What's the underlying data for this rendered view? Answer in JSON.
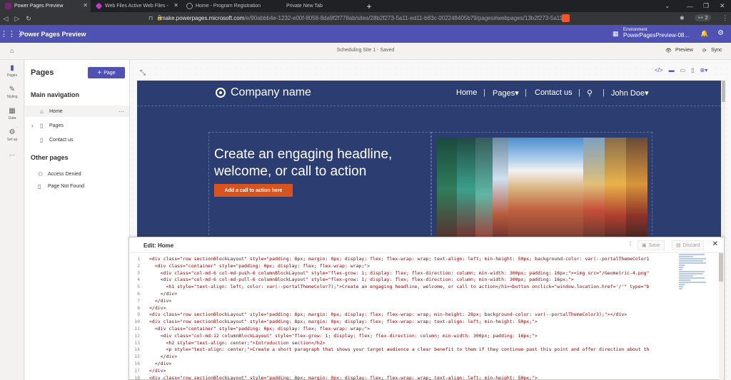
{
  "browser": {
    "tabs": [
      {
        "title": "Power Pages Preview",
        "active": true,
        "icon": "power-pages-icon",
        "color": "#742774"
      },
      {
        "title": "Web Files Active Web Files -",
        "active": false,
        "icon": "power-apps-icon",
        "color": "#c03bc4"
      },
      {
        "title": "Home - Program Registration",
        "active": false,
        "icon": "globe-icon",
        "color": "#9aa0a6"
      },
      {
        "title": "Private New Tab",
        "active": false,
        "icon": "",
        "color": ""
      }
    ],
    "new_tab_label": "+",
    "url_host": "make.powerpages.microsoft.com",
    "url_path": "/e/90abbb4e-1232-e00f-8058-8da9f2f778ab/sites/28b2f273-5a11-ed11-b83c-002248405b79/pages#webpages/13b2f273-5a11...",
    "extension_badge": "2"
  },
  "app": {
    "title": "Power Pages Preview",
    "environment_label": "Environment",
    "environment_name": "PowerPagesPreview-08..."
  },
  "commandbar": {
    "site_status": "Scheduling Site 1 - Saved",
    "preview_label": "Preview",
    "sync_label": "Sync"
  },
  "rail": [
    {
      "label": "Pages",
      "icon": "pages-icon",
      "active": true
    },
    {
      "label": "Styling",
      "icon": "styling-icon",
      "active": false
    },
    {
      "label": "Data",
      "icon": "data-icon",
      "active": false
    },
    {
      "label": "Set up",
      "icon": "setup-icon",
      "active": false
    },
    {
      "label": "...",
      "icon": "more-icon",
      "active": false
    }
  ],
  "pages_panel": {
    "title": "Pages",
    "add_button": "Page",
    "main_nav_title": "Main navigation",
    "main_nav": [
      {
        "label": "Home",
        "icon": "home-icon",
        "selected": true
      },
      {
        "label": "Pages",
        "icon": "page-icon",
        "expandable": true
      },
      {
        "label": "Contact us",
        "icon": "page-icon"
      }
    ],
    "other_pages_title": "Other pages",
    "other_pages": [
      {
        "label": "Access Denied",
        "icon": "user-icon"
      },
      {
        "label": "Page Not Found",
        "icon": "page-icon"
      }
    ]
  },
  "site_preview": {
    "company_name": "Company name",
    "nav": [
      "Home",
      "Pages▾",
      "Contact us",
      "John Doe▾"
    ],
    "headline": "Create an engaging headline, welcome, or call to action",
    "cta": "Add a call to action here"
  },
  "editor": {
    "title": "Edit: Home",
    "save_label": "Save",
    "discard_label": "Discard",
    "lines": [
      "<div class=\"row sectionBlockLayout\" style=\"padding: 8px; margin: 0px; display: flex; flex-wrap: wrap; text-align: left; min-height: 50px; background-color: var(--portalThemeColor1",
      "  <div class=\"container\" style=\"padding: 0px; display: flex; flex-wrap: wrap;\">",
      "    <div class=\"col-md-6 col-md-push-6 columnBlockLayout\" style=\"flex-grow: 1; display: flex; flex-direction: column; min-width: 300px; padding: 16px;\"><img src=\"/Geometric-4.png\"",
      "    <div class=\"col-md-6 col-md-pull-6 columnBlockLayout\" style=\"flex-grow: 1; display: flex; flex-direction: column; min-width: 300px; padding: 16px;\">",
      "      <h1 style=\"text-align: left; color: var(--portalThemeColor7);\">Create an engaging headline, welcome, or call to action</h1><button onclick=\"window.location.href='/'\" type=\"b",
      "    </div>",
      "  </div>",
      "</div>",
      "<div class=\"row sectionBlockLayout\" style=\"padding: 8px; margin: 0px; display: flex; flex-wrap: wrap; min-height: 28px; background-color: var(--portalThemeColor3);\"></div>",
      "<div class=\"row sectionBlockLayout\" style=\"padding: 8px; margin: 0px; display: flex; flex-wrap: wrap; text-align: left; min-height: 50px;\">",
      "  <div class=\"container\" style=\"padding: 0px; display: flex; flex-wrap: wrap;\">",
      "    <div class=\"col-md-12 columnBlockLayout\" style=\"flex-grow: 1; display: flex; flex-direction: column; min-width: 300px; padding: 16px;\">",
      "      <h2 style=\"text-align: center;\">Introduction section</h2>",
      "      <p style=\"text-align: center;\">Create a short paragraph that shows your target audience a clear benefit to them if they continue past this point and offer direction about th",
      "    </div>",
      "  </div>",
      "</div>",
      "<div class=\"row sectionBlockLayout\" style=\"padding: 8px; margin: 0px; display: flex; flex-wrap: wrap; text-align: left; min-height: 50px;\">"
    ]
  },
  "colors": {
    "brand": "#4f52b2",
    "site_bg": "#2c3e71",
    "cta": "#d9531e"
  }
}
